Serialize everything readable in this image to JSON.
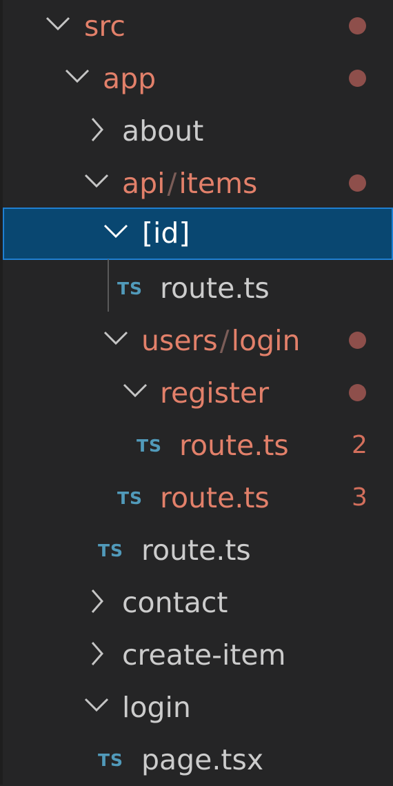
{
  "explorer": {
    "rows": [
      {
        "label": "src",
        "kind": "folder",
        "expanded": true,
        "modified": true,
        "decoration": "dot"
      },
      {
        "label": "app",
        "kind": "folder",
        "expanded": true,
        "modified": true,
        "decoration": "dot"
      },
      {
        "label": "about",
        "kind": "folder",
        "expanded": false,
        "modified": false
      },
      {
        "label_parts": [
          "api",
          "items"
        ],
        "kind": "folder",
        "expanded": true,
        "modified": true,
        "decoration": "dot"
      },
      {
        "label": "[id]",
        "kind": "folder",
        "expanded": true,
        "modified": false,
        "selected": true
      },
      {
        "label": "route.ts",
        "kind": "file",
        "icon_text": "TS",
        "modified": false
      },
      {
        "label_parts": [
          "users",
          "login"
        ],
        "kind": "folder",
        "expanded": true,
        "modified": true,
        "decoration": "dot"
      },
      {
        "label": "register",
        "kind": "folder",
        "expanded": true,
        "modified": true,
        "decoration": "dot"
      },
      {
        "label": "route.ts",
        "kind": "file",
        "icon_text": "TS",
        "modified": true,
        "problems": "2"
      },
      {
        "label": "route.ts",
        "kind": "file",
        "icon_text": "TS",
        "modified": true,
        "problems": "3"
      },
      {
        "label": "route.ts",
        "kind": "file",
        "icon_text": "TS",
        "modified": false
      },
      {
        "label": "contact",
        "kind": "folder",
        "expanded": false,
        "modified": false
      },
      {
        "label": "create-item",
        "kind": "folder",
        "expanded": false,
        "modified": false
      },
      {
        "label": "login",
        "kind": "folder",
        "expanded": true,
        "modified": false
      },
      {
        "label": "page.tsx",
        "kind": "file",
        "icon_text": "TS",
        "modified": false
      }
    ]
  },
  "colors": {
    "background": "#252526",
    "selection": "#094771",
    "selection_border": "#1f7fd1",
    "modified_text": "#e2806a",
    "normal_text": "#cccccc",
    "ts_icon": "#519aba",
    "dot": "#8e4f4b"
  }
}
